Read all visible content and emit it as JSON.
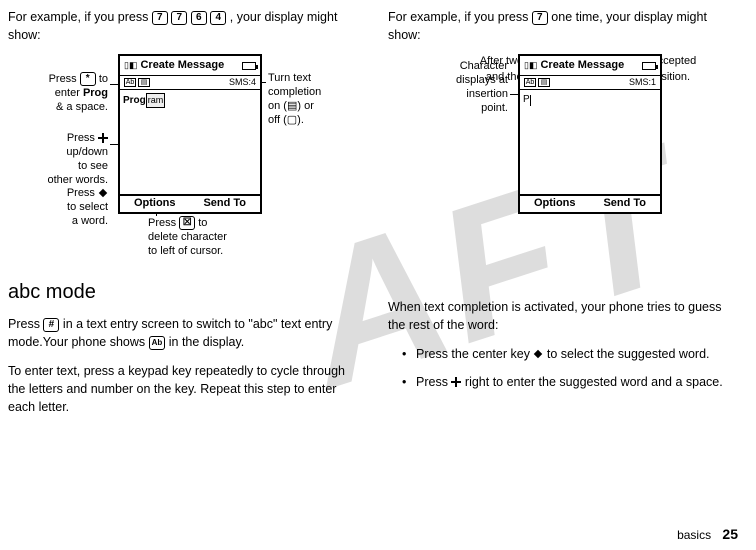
{
  "watermark": "AFT",
  "left": {
    "intro_prefix": "For example, if you press ",
    "keys": [
      "7",
      "7",
      "6",
      "4"
    ],
    "intro_suffix": ", your display might show:",
    "phone": {
      "title": "Create Message",
      "sms_label": "SMS:4",
      "text_main": "Prog",
      "text_complete": "ram",
      "soft_left": "Options",
      "soft_right": "Send To"
    },
    "ann_star_l1": "Press",
    "ann_star_key": "*",
    "ann_star_l2": "to",
    "ann_star_l3": "enter",
    "ann_star_bold": "Prog",
    "ann_star_l4": "& a space.",
    "ann_nav_l1": "Press",
    "ann_nav_l2": "up/down",
    "ann_nav_l3": "to see",
    "ann_nav_l4": "other words.",
    "ann_nav_l5": "Press",
    "ann_nav_l6": "to select",
    "ann_nav_l7": "a word.",
    "ann_delete_l1": "Press",
    "ann_delete_key": "☒",
    "ann_delete_l2": "to",
    "ann_delete_l3": "delete character",
    "ann_delete_l4": "to left of cursor.",
    "ann_comp_l1": "Turn text",
    "ann_comp_l2": "completion",
    "ann_comp_l3": "on (",
    "ann_comp_icon1": "▤",
    "ann_comp_l4": ") or",
    "ann_comp_l5": "off (",
    "ann_comp_icon2": "▢",
    "ann_comp_l6": ").",
    "section_title": "abc mode",
    "abc_para_l1": "Press ",
    "abc_key": "#",
    "abc_para_l2": " in a text entry screen to switch to \"abc\" text entry mode.Your phone shows ",
    "abc_icon": "Ab",
    "abc_para_l3": " in the display.",
    "abc_para2": "To enter text, press a keypad key repeatedly to cycle through the letters and number on the key. Repeat this step to enter each letter."
  },
  "right": {
    "intro_prefix": "For example, if you press ",
    "key": "7",
    "intro_suffix": " one time, your display might show:",
    "ann_char_l1": "Character",
    "ann_char_l2": "displays at",
    "ann_char_l3": "insertion",
    "ann_char_l4": "point.",
    "phone": {
      "title": "Create Message",
      "sms_label": "SMS:1",
      "char": "P",
      "soft_left": "Options",
      "soft_right": "Send To"
    },
    "caption": "After two seconds, the character is accepted and the cursor moves to the next position.",
    "para1": "When text completion is activated, your phone tries to guess the rest of the word:",
    "bullet1_l1": "Press the center key ",
    "bullet1_l2": " to select the suggested word.",
    "bullet2_l1": "Press ",
    "bullet2_l2": " right to enter the suggested word and a space."
  },
  "footer_label": "basics",
  "footer_page": "25"
}
